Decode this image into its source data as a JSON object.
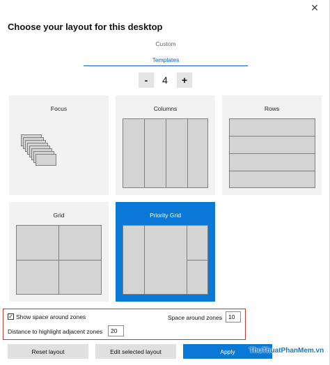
{
  "window": {
    "close_glyph": "✕"
  },
  "title": "Choose your layout for this desktop",
  "tabs": [
    {
      "label": "Custom",
      "selected": false
    },
    {
      "label": "Templates",
      "selected": true
    }
  ],
  "zone_count": {
    "minus": "-",
    "value": "4",
    "plus": "+"
  },
  "templates": [
    {
      "label": "Focus",
      "selected": false
    },
    {
      "label": "Columns",
      "selected": false
    },
    {
      "label": "Rows",
      "selected": false
    },
    {
      "label": "Grid",
      "selected": false
    },
    {
      "label": "Priority Grid",
      "selected": true
    }
  ],
  "settings": {
    "show_space_label": "Show space around zones",
    "show_space_checked": true,
    "checkmark": "✓",
    "space_around_label": "Space around zones",
    "space_around_value": "10",
    "distance_label": "Distance to highlight adjacent zones",
    "distance_value": "20"
  },
  "footer": {
    "reset_label": "Reset layout",
    "edit_label": "Edit selected layout",
    "apply_label": "Apply"
  },
  "watermark": "ThuThuatPhanMem.vn",
  "colors": {
    "accent": "#0a78d7",
    "highlight_border": "#d2322d"
  }
}
